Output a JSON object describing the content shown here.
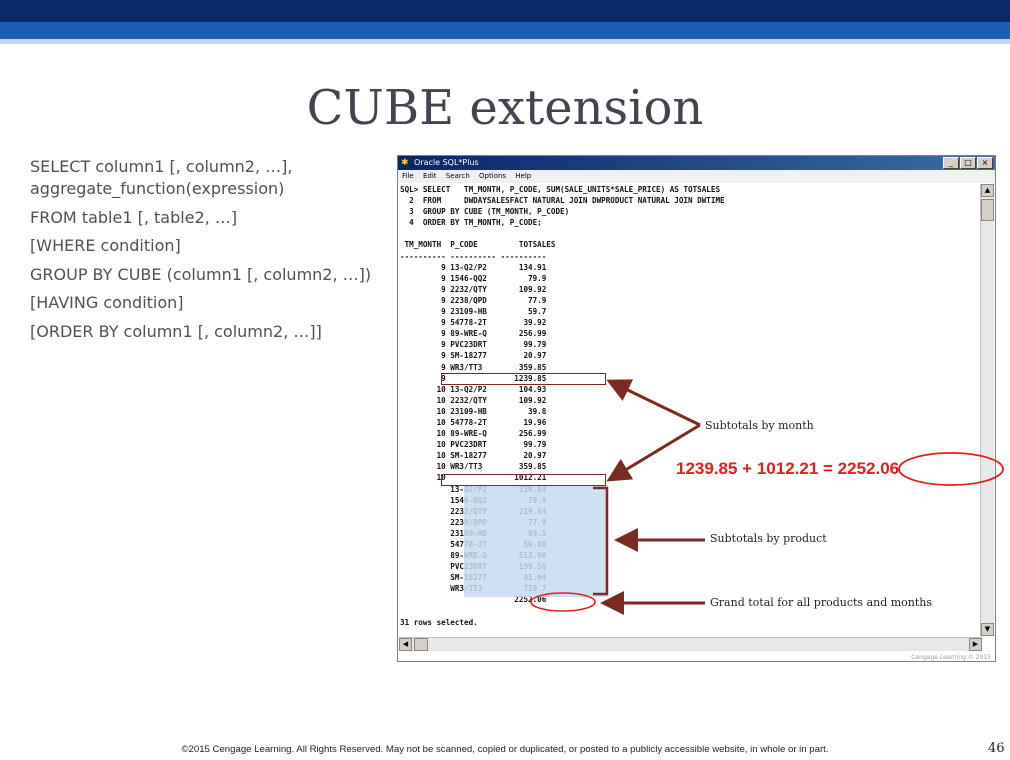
{
  "slide": {
    "title": "CUBE extension",
    "syntax_lines": [
      "SELECT column1 [, column2, …],",
      "aggregate_function(expression)",
      "FROM table1 [, table2, …]",
      "[WHERE condition]",
      "GROUP BY CUBE (column1 [, column2, …])",
      "[HAVING condition]",
      "[ORDER BY column1 [, column2, …]]"
    ],
    "footer": "©2015 Cengage Learning. All Rights Reserved. May not be scanned, copied or duplicated, or posted to a publicly accessible website, in whole or in part.",
    "page_number": "46"
  },
  "window": {
    "title": "Oracle SQL*Plus",
    "menu": [
      "File",
      "Edit",
      "Search",
      "Options",
      "Help"
    ],
    "footer": "Cengage Learning © 2015"
  },
  "query": [
    "SQL> SELECT   TM_MONTH, P_CODE, SUM(SALE_UNITS*SALE_PRICE) AS TOTSALES",
    "  2  FROM     DWDAYSALESFACT NATURAL JOIN DWPRODUCT NATURAL JOIN DWTIME",
    "  3  GROUP BY CUBE (TM_MONTH, P_CODE)",
    "  4  ORDER BY TM_MONTH, P_CODE;"
  ],
  "result": {
    "headers": [
      "TM_MONTH",
      "P_CODE",
      "TOTSALES"
    ],
    "rows": [
      [
        "9",
        "13-Q2/P2",
        "134.91"
      ],
      [
        "9",
        "1546-QQ2",
        "79.9"
      ],
      [
        "9",
        "2232/QTY",
        "109.92"
      ],
      [
        "9",
        "2238/QPD",
        "77.9"
      ],
      [
        "9",
        "23109-HB",
        "59.7"
      ],
      [
        "9",
        "54778-2T",
        "39.92"
      ],
      [
        "9",
        "89-WRE-Q",
        "256.99"
      ],
      [
        "9",
        "PVC23DRT",
        "99.79"
      ],
      [
        "9",
        "SM-18277",
        "20.97"
      ],
      [
        "9",
        "WR3/TT3",
        "359.85"
      ],
      [
        "9",
        "",
        "1239.85"
      ],
      [
        "10",
        "13-Q2/P2",
        "104.93"
      ],
      [
        "10",
        "2232/QTY",
        "109.92"
      ],
      [
        "10",
        "23109-HB",
        "39.8"
      ],
      [
        "10",
        "54778-2T",
        "19.96"
      ],
      [
        "10",
        "89-WRE-Q",
        "256.99"
      ],
      [
        "10",
        "PVC23DRT",
        "99.79"
      ],
      [
        "10",
        "SM-18277",
        "20.97"
      ],
      [
        "10",
        "WR3/TT3",
        "359.85"
      ],
      [
        "10",
        "",
        "1012.21"
      ],
      [
        "",
        "13-Q2/P2",
        "239.84"
      ],
      [
        "",
        "1546-QQ2",
        "79.9"
      ],
      [
        "",
        "2232/QTY",
        "219.84"
      ],
      [
        "",
        "2238/QPD",
        "77.9"
      ],
      [
        "",
        "23109-HB",
        "99.5"
      ],
      [
        "",
        "54778-2T",
        "59.88"
      ],
      [
        "",
        "89-WRE-Q",
        "513.98"
      ],
      [
        "",
        "PVC23DRT",
        "199.58"
      ],
      [
        "",
        "SM-18277",
        "41.94"
      ],
      [
        "",
        "WR3/TT3",
        "719.7"
      ],
      [
        "",
        "",
        "2252.06"
      ]
    ],
    "rows_selected": "31 rows selected."
  },
  "annotations": {
    "subtotals_month": "Subtotals by month",
    "subtotals_product": "Subtotals by product",
    "grand_total": "Grand total for all products and months",
    "equation_prefix": "1239.85 + 1012.21 = ",
    "equation_result": "2252.06"
  },
  "colors": {
    "top_bar": "#0b2a6b",
    "mid_bar": "#1a5fb4",
    "arrow": "#7a2a20",
    "highlight_red": "#e0201a",
    "product_shade": "#c5dcf0"
  }
}
